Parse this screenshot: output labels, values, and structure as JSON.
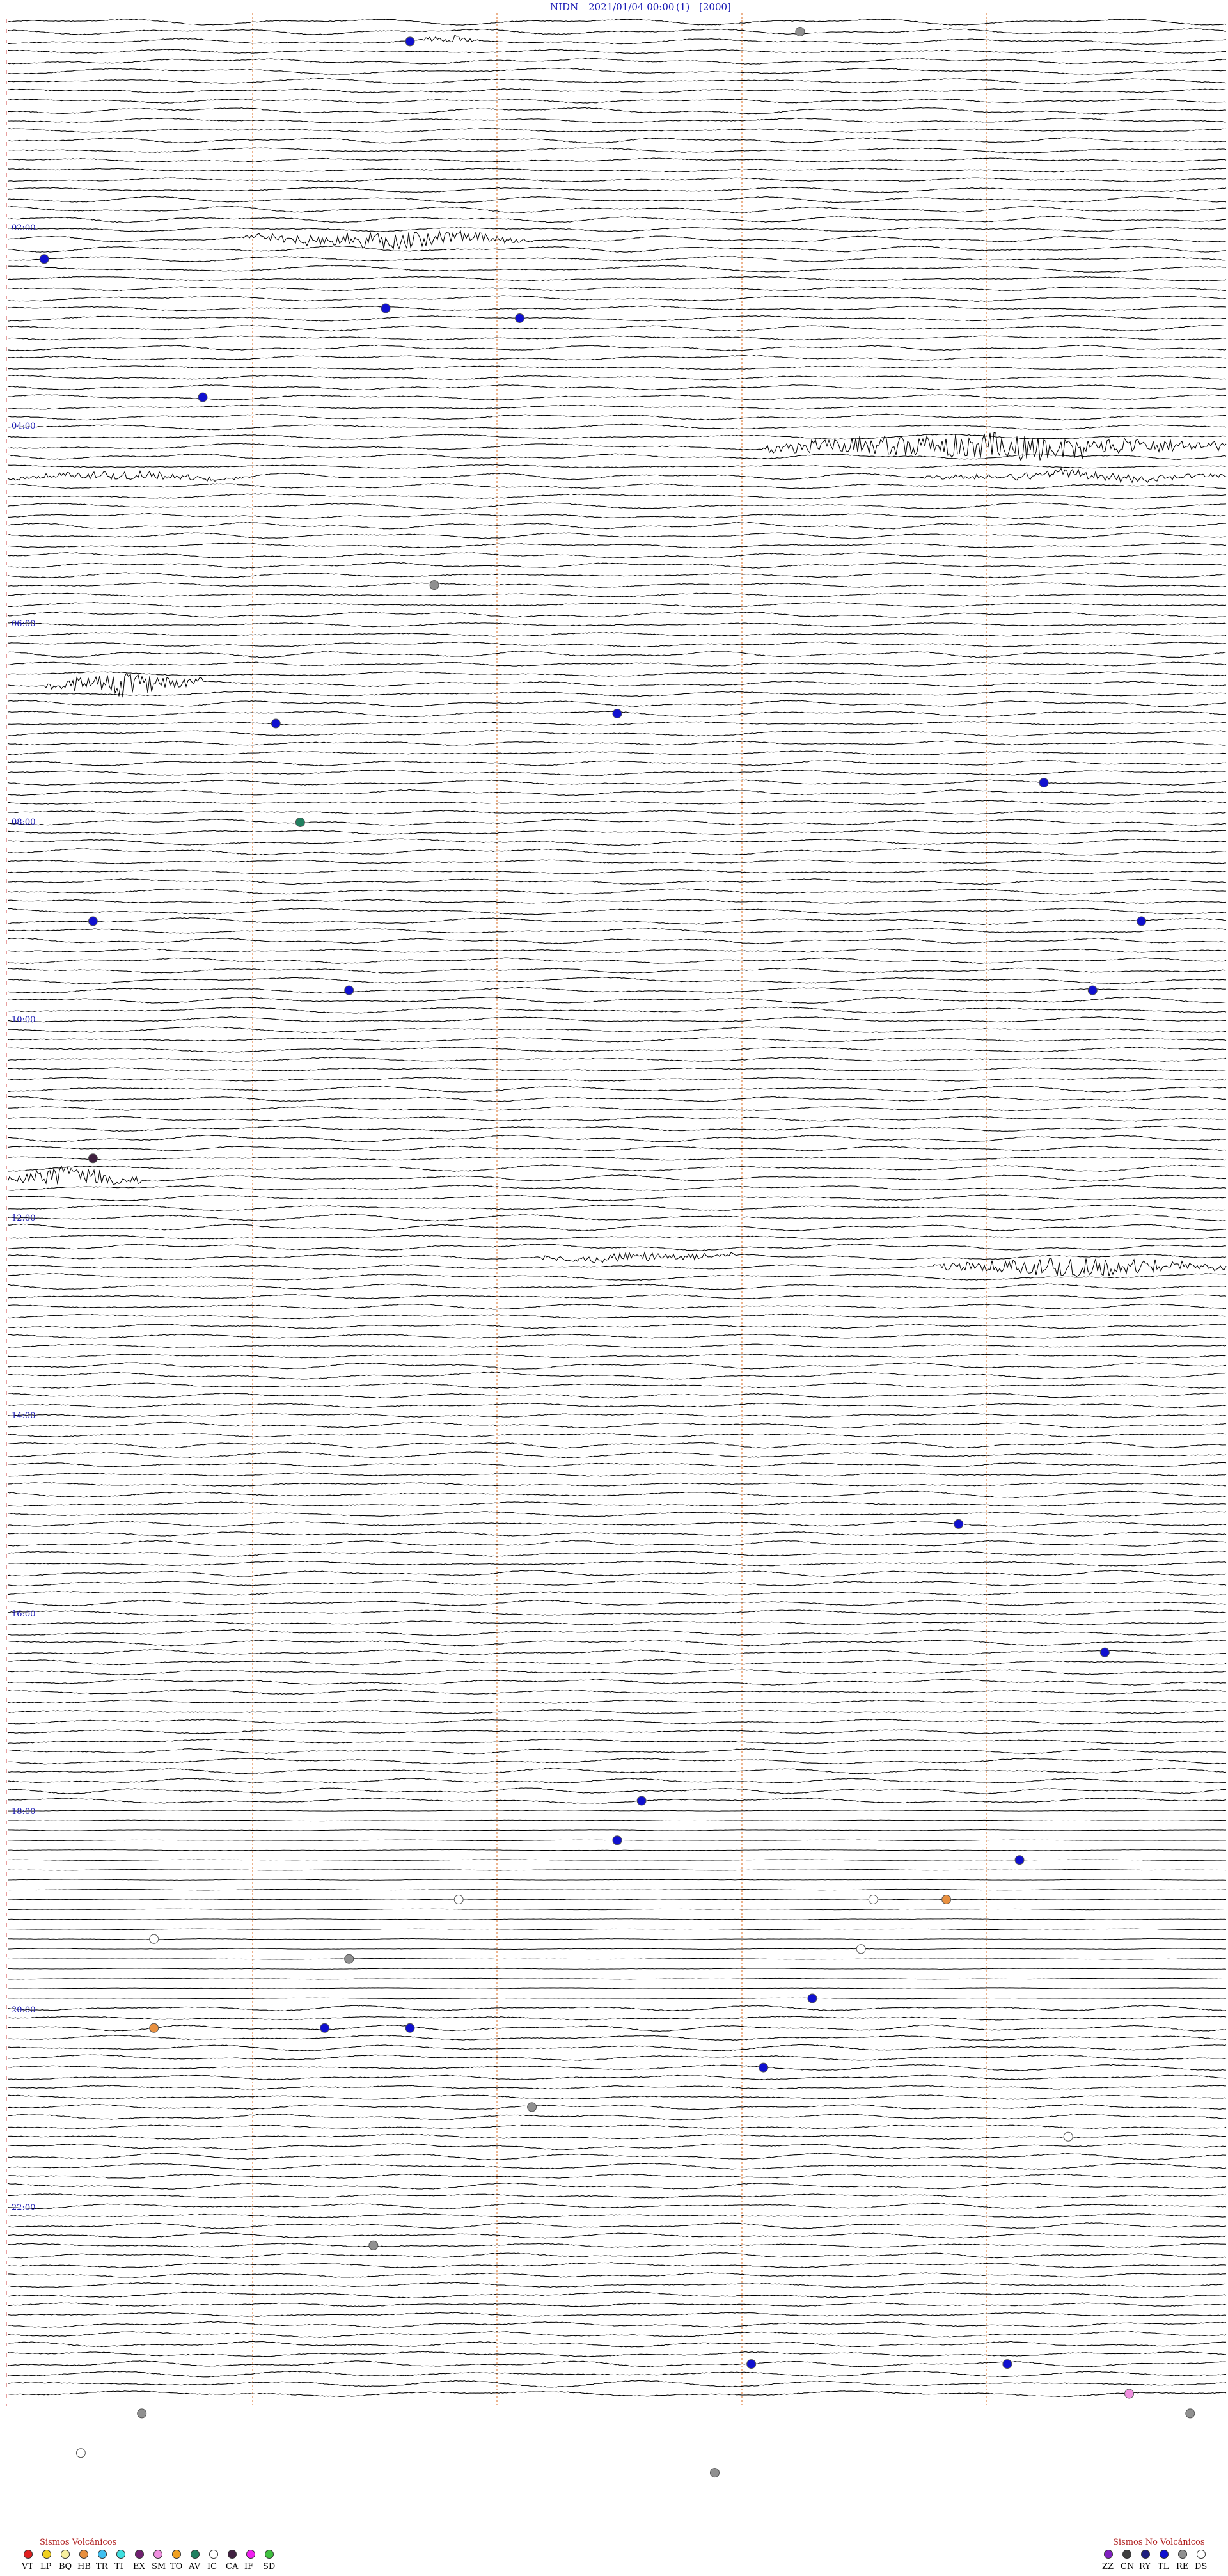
{
  "header": {
    "station": "NIDN",
    "datetime": "2021/01/04 00:00",
    "component": "(1)",
    "scale": "[2000]"
  },
  "chart_data": {
    "type": "helicorder",
    "title": "NIDN 2021/01/04 00:00 (1) [2000]",
    "trace_count": 144,
    "minutes_per_trace": 10,
    "hour_labels": [
      "02:00",
      "04:00",
      "06:00",
      "08:00",
      "10:00",
      "12:00",
      "14:00",
      "16:00",
      "18:00",
      "20:00",
      "22:00"
    ],
    "quiet_window": {
      "from": "18:00",
      "to": "20:00"
    },
    "bursts": [
      {
        "trace": 2,
        "start": 0.34,
        "end": 0.39,
        "amp": 6
      },
      {
        "trace": 22,
        "start": 0.19,
        "end": 0.43,
        "amp": 14
      },
      {
        "trace": 43,
        "start": 0.62,
        "end": 1.0,
        "amp": 22
      },
      {
        "trace": 46,
        "start": 0.0,
        "end": 0.2,
        "amp": 7
      },
      {
        "trace": 46,
        "start": 0.75,
        "end": 1.0,
        "amp": 8
      },
      {
        "trace": 67,
        "start": 0.03,
        "end": 0.16,
        "amp": 20
      },
      {
        "trace": 117,
        "start": 0.0,
        "end": 0.11,
        "amp": 18
      },
      {
        "trace": 125,
        "start": 0.43,
        "end": 0.6,
        "amp": 8
      },
      {
        "trace": 126,
        "start": 0.76,
        "end": 1.0,
        "amp": 16
      }
    ],
    "events": [
      {
        "trace": 2,
        "pos": 0.33,
        "class": "TL"
      },
      {
        "trace": 1,
        "pos": 0.65,
        "class": "RE"
      },
      {
        "trace": 24,
        "pos": 0.03,
        "class": "TL"
      },
      {
        "trace": 29,
        "pos": 0.31,
        "class": "TL"
      },
      {
        "trace": 30,
        "pos": 0.42,
        "class": "TL"
      },
      {
        "trace": 38,
        "pos": 0.16,
        "class": "TL"
      },
      {
        "trace": 57,
        "pos": 0.35,
        "class": "RE"
      },
      {
        "trace": 71,
        "pos": 0.22,
        "class": "TL"
      },
      {
        "trace": 70,
        "pos": 0.5,
        "class": "TL"
      },
      {
        "trace": 77,
        "pos": 0.85,
        "class": "TL"
      },
      {
        "trace": 81,
        "pos": 0.24,
        "class": "AV"
      },
      {
        "trace": 91,
        "pos": 0.07,
        "class": "TL"
      },
      {
        "trace": 91,
        "pos": 0.93,
        "class": "TL"
      },
      {
        "trace": 98,
        "pos": 0.28,
        "class": "TL"
      },
      {
        "trace": 98,
        "pos": 0.89,
        "class": "TL"
      },
      {
        "trace": 115,
        "pos": 0.07,
        "class": "CA"
      },
      {
        "trace": 152,
        "pos": 0.78,
        "class": "TL"
      },
      {
        "trace": 165,
        "pos": 0.9,
        "class": "TL"
      },
      {
        "trace": 180,
        "pos": 0.52,
        "class": "TL"
      },
      {
        "trace": 184,
        "pos": 0.5,
        "class": "TL"
      },
      {
        "trace": 186,
        "pos": 0.83,
        "class": "TL"
      },
      {
        "trace": 200,
        "pos": 0.66,
        "class": "TL"
      },
      {
        "trace": 203,
        "pos": 0.26,
        "class": "TL"
      },
      {
        "trace": 203,
        "pos": 0.33,
        "class": "TL"
      },
      {
        "trace": 207,
        "pos": 0.62,
        "class": "TL"
      },
      {
        "trace": 237,
        "pos": 0.61,
        "class": "TL"
      },
      {
        "trace": 237,
        "pos": 0.82,
        "class": "TL"
      },
      {
        "trace": 240,
        "pos": 0.92,
        "class": "SM"
      },
      {
        "trace": 190,
        "pos": 0.37,
        "class": "IC"
      },
      {
        "trace": 190,
        "pos": 0.71,
        "class": "IC"
      },
      {
        "trace": 190,
        "pos": 0.77,
        "class": "HB"
      },
      {
        "trace": 194,
        "pos": 0.12,
        "class": "IC"
      },
      {
        "trace": 196,
        "pos": 0.28,
        "class": "RE"
      },
      {
        "trace": 195,
        "pos": 0.7,
        "class": "IC"
      },
      {
        "trace": 203,
        "pos": 0.12,
        "class": "HB"
      },
      {
        "trace": 211,
        "pos": 0.43,
        "class": "RE"
      },
      {
        "trace": 214,
        "pos": 0.87,
        "class": "IC"
      },
      {
        "trace": 225,
        "pos": 0.3,
        "class": "RE"
      },
      {
        "trace": 242,
        "pos": 0.11,
        "class": "RE"
      },
      {
        "trace": 242,
        "pos": 0.97,
        "class": "RE"
      },
      {
        "trace": 246,
        "pos": 0.06,
        "class": "IC"
      },
      {
        "trace": 248,
        "pos": 0.58,
        "class": "RE"
      }
    ]
  },
  "legend": {
    "volcanic": {
      "title": "Sismos Volcánicos",
      "items": [
        {
          "code": "VT",
          "color": "#e02020"
        },
        {
          "code": "LP",
          "color": "#f0d020"
        },
        {
          "code": "BQ",
          "color": "#f8f0a0"
        },
        {
          "code": "HB",
          "color": "#e89040"
        },
        {
          "code": "TR",
          "color": "#40c0f0"
        },
        {
          "code": "TI",
          "color": "#40e0e0"
        },
        {
          "code": "EX",
          "color": "#702070"
        },
        {
          "code": "SM",
          "color": "#f090e0"
        },
        {
          "code": "TO",
          "color": "#f0a020"
        },
        {
          "code": "AV",
          "color": "#208060"
        },
        {
          "code": "IC",
          "color": "#ffffff"
        },
        {
          "code": "CA",
          "color": "#402040"
        },
        {
          "code": "IF",
          "color": "#f020f0"
        },
        {
          "code": "SD",
          "color": "#40c040"
        }
      ]
    },
    "nonvolcanic": {
      "title": "Sismos No Volcánicos",
      "items": [
        {
          "code": "ZZ",
          "color": "#8020c0"
        },
        {
          "code": "CN",
          "color": "#404040"
        },
        {
          "code": "RY",
          "color": "#202080"
        },
        {
          "code": "TL",
          "color": "#1010d0"
        },
        {
          "code": "RE",
          "color": "#909090"
        },
        {
          "code": "DS",
          "color": "#ffffff"
        }
      ]
    }
  }
}
